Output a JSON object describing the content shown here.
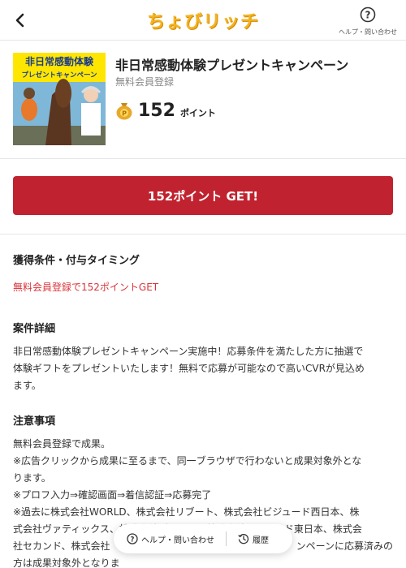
{
  "header": {
    "logo_text": "ちょびリッチ",
    "help_label": "ヘルプ・問い合わせ"
  },
  "product": {
    "thumb_text_line1": "非日常感動体験",
    "thumb_text_line2": "プレゼントキャンペーン",
    "title": "非日常感動体験プレゼントキャンペーン",
    "subtitle": "無料会員登録",
    "points": "152",
    "points_unit": "ポイント"
  },
  "cta": {
    "label": "152ポイント GET!"
  },
  "conditions": {
    "heading": "獲得条件・付与タイミング",
    "text": "無料会員登録で152ポイントGET"
  },
  "details": {
    "heading": "案件詳細",
    "lines": [
      "非日常感動体験プレゼントキャンペーン実施中！応募条件を満たした方に抽選で",
      "体験ギフトをプレゼントいたします！無料で応募が可能なので高いCVRが見込め",
      "ます。"
    ]
  },
  "notes": {
    "heading": "注意事項",
    "lines": [
      "無料会員登録で成果。",
      "※広告クリックから成果に至るまで、同一ブラウザで行わないと成果対象外とな",
      "ります。",
      "※プロフ入力⇒確認画面⇒着信認証⇒応募完了",
      "※過去に株式会社WORLD、株式会社リブート、株式会社ビジュード西日本、株",
      "式会社ヴァティックス、株式会社デジタル、株式会社ビジュード東日本、株式会",
      "社セカンド、株式会社",
      "ンペーンに応募済みの",
      "方は成果対象外となりま"
    ]
  },
  "floating_bar": {
    "help_label": "ヘルプ・問い合わせ",
    "history_label": "履歴"
  },
  "colors": {
    "accent_red": "#c0232f",
    "logo_yellow": "#f4b322",
    "condition_red": "#d9343a"
  }
}
